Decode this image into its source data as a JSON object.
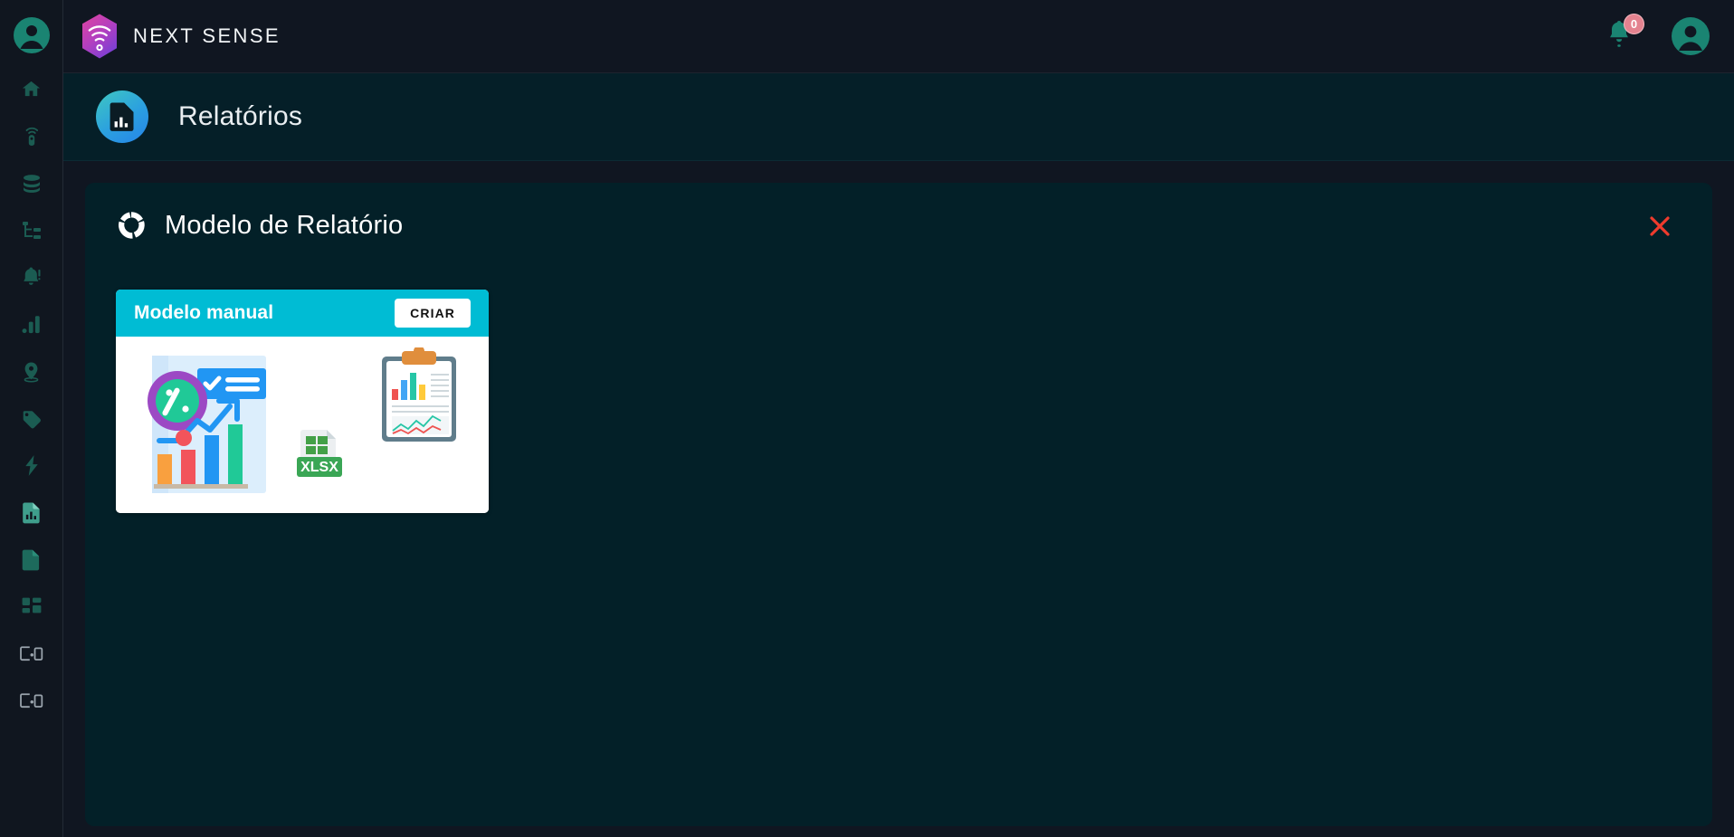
{
  "app": {
    "brand_name": "NEXT SENSE",
    "logo_icon": "wifi-hexagon-logo"
  },
  "sidebar": {
    "avatar_icon": "user-avatar-icon",
    "items": [
      {
        "icon": "home-icon",
        "name": "home",
        "active": false
      },
      {
        "icon": "sensor-device-icon",
        "name": "devices",
        "active": false
      },
      {
        "icon": "database-icon",
        "name": "database",
        "active": false
      },
      {
        "icon": "hierarchy-icon",
        "name": "hierarchy",
        "active": false
      },
      {
        "icon": "bell-alert-icon",
        "name": "alerts",
        "active": false
      },
      {
        "icon": "bar-chart-icon",
        "name": "analytics",
        "active": false
      },
      {
        "icon": "location-pin-icon",
        "name": "locations",
        "active": false
      },
      {
        "icon": "tag-icon",
        "name": "tags",
        "active": false
      },
      {
        "icon": "bolt-icon",
        "name": "energy",
        "active": false
      },
      {
        "icon": "report-doc-icon",
        "name": "reports",
        "active": true
      },
      {
        "icon": "document-icon",
        "name": "documents",
        "active": false
      },
      {
        "icon": "grid-icon",
        "name": "dashboards",
        "active": false
      },
      {
        "icon": "monitor-icon",
        "name": "screens-1",
        "active": false
      },
      {
        "icon": "monitor-icon",
        "name": "screens-2",
        "active": false
      }
    ]
  },
  "topbar": {
    "notifications_count": "0",
    "bell_icon": "bell-icon",
    "avatar_icon": "user-avatar-icon"
  },
  "page_header": {
    "title": "Relatórios",
    "icon": "report-chart-icon"
  },
  "panel": {
    "title": "Modelo de Relatório",
    "icon": "donut-chart-icon",
    "close_icon": "close-x-icon"
  },
  "cards": [
    {
      "title": "Modelo manual",
      "button_label": "CRIAR",
      "illustration": "report-analytics-xlsx-clipboard"
    }
  ],
  "colors": {
    "page_background": "#101621",
    "panel_background": "#032028",
    "page_header_background": "#051f28",
    "card_header": "#00bcd4",
    "accent_teal": "#1f7a6b",
    "badge_pink": "#e4828f",
    "close_red": "#ef3b2d",
    "brand_magenta": "#cc3bb0"
  }
}
